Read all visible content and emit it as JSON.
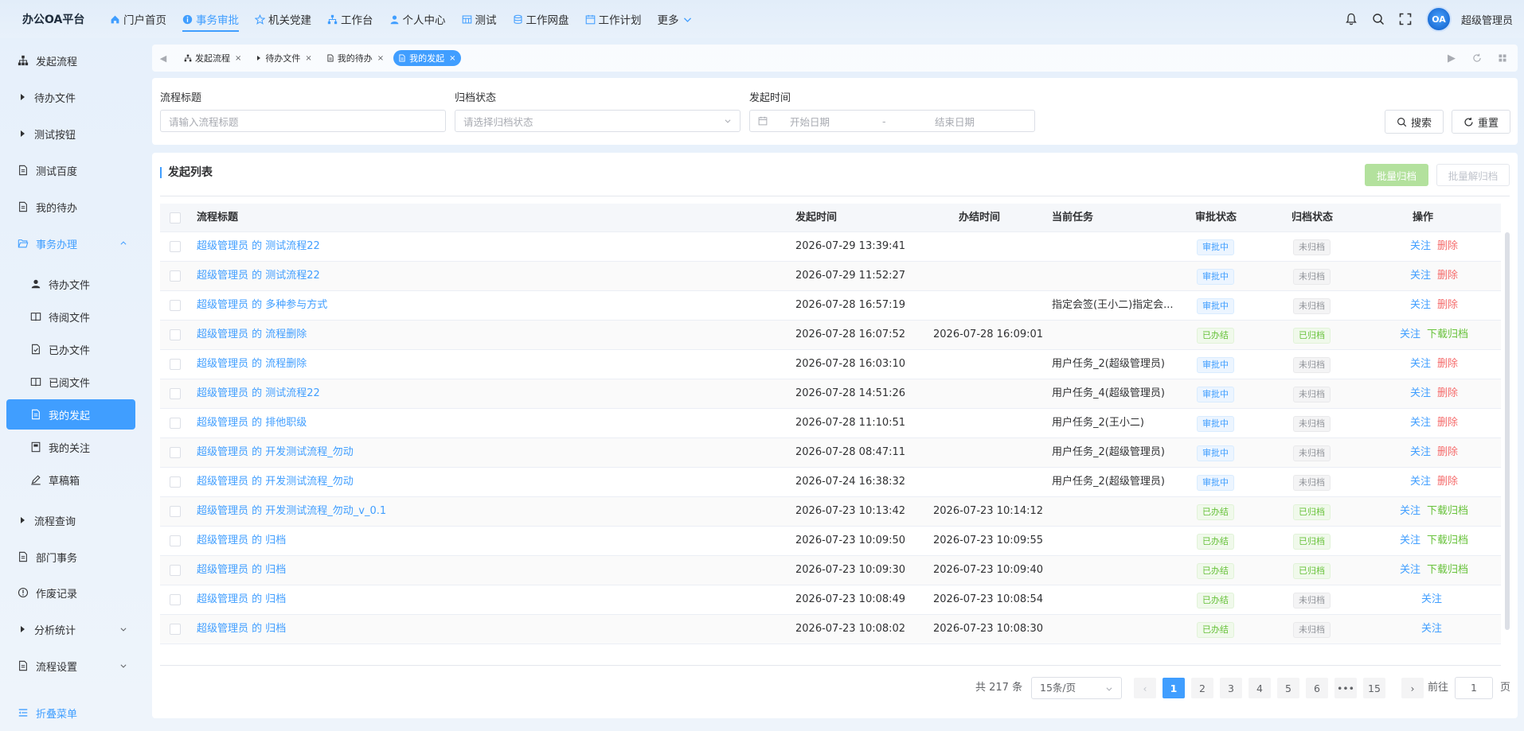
{
  "app": {
    "brand": "办公OA平台"
  },
  "topnav": [
    {
      "label": "门户首页",
      "icon": "home-icon",
      "active": false
    },
    {
      "label": "事务审批",
      "icon": "info-icon",
      "active": true
    },
    {
      "label": "机关党建",
      "icon": "star-icon",
      "active": false
    },
    {
      "label": "工作台",
      "icon": "org-icon",
      "active": false
    },
    {
      "label": "个人中心",
      "icon": "user-icon",
      "active": false
    },
    {
      "label": "测试",
      "icon": "grid-icon",
      "active": false
    },
    {
      "label": "工作网盘",
      "icon": "database-icon",
      "active": false
    },
    {
      "label": "工作计划",
      "icon": "calendar-icon",
      "active": false
    },
    {
      "label": "更多",
      "icon": "chevron-down-icon",
      "active": false
    }
  ],
  "user": {
    "avatar_text": "OA",
    "name": "超级管理员"
  },
  "sidebar": {
    "items": [
      {
        "label": "发起流程",
        "icon": "org-icon"
      },
      {
        "label": "待办文件",
        "icon": "triangle-right-icon"
      },
      {
        "label": "测试按钮",
        "icon": "triangle-right-icon"
      },
      {
        "label": "测试百度",
        "icon": "document-icon"
      },
      {
        "label": "我的待办",
        "icon": "document-icon"
      },
      {
        "label": "事务办理",
        "icon": "folder-open-icon"
      },
      {
        "label": "待办文件",
        "icon": "user-icon"
      },
      {
        "label": "待阅文件",
        "icon": "book-icon"
      },
      {
        "label": "已办文件",
        "icon": "document-check-icon"
      },
      {
        "label": "已阅文件",
        "icon": "book-icon"
      },
      {
        "label": "我的发起",
        "icon": "document-icon"
      },
      {
        "label": "我的关注",
        "icon": "notebook-icon"
      },
      {
        "label": "草稿箱",
        "icon": "edit-icon"
      },
      {
        "label": "流程查询",
        "icon": "triangle-right-icon"
      },
      {
        "label": "部门事务",
        "icon": "document-icon"
      },
      {
        "label": "作废记录",
        "icon": "warning-icon"
      },
      {
        "label": "分析统计",
        "icon": "triangle-right-icon"
      },
      {
        "label": "流程设置",
        "icon": "document-icon"
      }
    ],
    "collapse_label": "折叠菜单"
  },
  "tabs": [
    {
      "label": "发起流程",
      "icon": "org-icon",
      "active": false
    },
    {
      "label": "待办文件",
      "icon": "triangle-right-icon",
      "active": false
    },
    {
      "label": "我的待办",
      "icon": "document-icon",
      "active": false
    },
    {
      "label": "我的发起",
      "icon": "document-icon",
      "active": true
    }
  ],
  "search": {
    "title_label": "流程标题",
    "title_placeholder": "请输入流程标题",
    "archive_label": "归档状态",
    "archive_placeholder": "请选择归档状态",
    "time_label": "发起时间",
    "start_placeholder": "开始日期",
    "range_sep": "-",
    "end_placeholder": "结束日期",
    "search_button": "搜索",
    "reset_button": "重置"
  },
  "list": {
    "title": "发起列表",
    "bulk_archive": "批量归档",
    "bulk_unarchive": "批量解归档",
    "columns": [
      "流程标题",
      "发起时间",
      "办结时间",
      "当前任务",
      "审批状态",
      "归档状态",
      "操作"
    ],
    "rows": [
      {
        "title": "超级管理员 的 测试流程22",
        "start": "2026-07-29 13:39:41",
        "end": "",
        "task": "",
        "approval": "审批中",
        "archive": "未归档",
        "actions": [
          "关注",
          "删除"
        ]
      },
      {
        "title": "超级管理员 的 测试流程22",
        "start": "2026-07-29 11:52:27",
        "end": "",
        "task": "",
        "approval": "审批中",
        "archive": "未归档",
        "actions": [
          "关注",
          "删除"
        ]
      },
      {
        "title": "超级管理员 的 多种参与方式",
        "start": "2026-07-28 16:57:19",
        "end": "",
        "task": "指定会签(王小二)指定会...",
        "approval": "审批中",
        "archive": "未归档",
        "actions": [
          "关注",
          "删除"
        ]
      },
      {
        "title": "超级管理员 的 流程删除",
        "start": "2026-07-28 16:07:52",
        "end": "2026-07-28 16:09:01",
        "task": "",
        "approval": "已办结",
        "archive": "已归档",
        "actions": [
          "关注",
          "下载归档"
        ]
      },
      {
        "title": "超级管理员 的 流程删除",
        "start": "2026-07-28 16:03:10",
        "end": "",
        "task": "用户任务_2(超级管理员)",
        "approval": "审批中",
        "archive": "未归档",
        "actions": [
          "关注",
          "删除"
        ]
      },
      {
        "title": "超级管理员 的 测试流程22",
        "start": "2026-07-28 14:51:26",
        "end": "",
        "task": "用户任务_4(超级管理员)",
        "approval": "审批中",
        "archive": "未归档",
        "actions": [
          "关注",
          "删除"
        ]
      },
      {
        "title": "超级管理员 的 排他职级",
        "start": "2026-07-28 11:10:51",
        "end": "",
        "task": "用户任务_2(王小二)",
        "approval": "审批中",
        "archive": "未归档",
        "actions": [
          "关注",
          "删除"
        ]
      },
      {
        "title": "超级管理员 的 开发测试流程_勿动",
        "start": "2026-07-28 08:47:11",
        "end": "",
        "task": "用户任务_2(超级管理员)",
        "approval": "审批中",
        "archive": "未归档",
        "actions": [
          "关注",
          "删除"
        ]
      },
      {
        "title": "超级管理员 的 开发测试流程_勿动",
        "start": "2026-07-24 16:38:32",
        "end": "",
        "task": "用户任务_2(超级管理员)",
        "approval": "审批中",
        "archive": "未归档",
        "actions": [
          "关注",
          "删除"
        ]
      },
      {
        "title": "超级管理员 的 开发测试流程_勿动_v_0.1",
        "start": "2026-07-23 10:13:42",
        "end": "2026-07-23 10:14:12",
        "task": "",
        "approval": "已办结",
        "archive": "已归档",
        "actions": [
          "关注",
          "下载归档"
        ]
      },
      {
        "title": "超级管理员 的 归档",
        "start": "2026-07-23 10:09:50",
        "end": "2026-07-23 10:09:55",
        "task": "",
        "approval": "已办结",
        "archive": "已归档",
        "actions": [
          "关注",
          "下载归档"
        ]
      },
      {
        "title": "超级管理员 的 归档",
        "start": "2026-07-23 10:09:30",
        "end": "2026-07-23 10:09:40",
        "task": "",
        "approval": "已办结",
        "archive": "已归档",
        "actions": [
          "关注",
          "下载归档"
        ]
      },
      {
        "title": "超级管理员 的 归档",
        "start": "2026-07-23 10:08:49",
        "end": "2026-07-23 10:08:54",
        "task": "",
        "approval": "已办结",
        "archive": "未归档",
        "actions": [
          "关注"
        ]
      },
      {
        "title": "超级管理员 的 归档",
        "start": "2026-07-23 10:08:02",
        "end": "2026-07-23 10:08:30",
        "task": "",
        "approval": "已办结",
        "archive": "未归档",
        "actions": [
          "关注"
        ]
      }
    ]
  },
  "pagination": {
    "total_text": "共 217 条",
    "page_size": "15条/页",
    "pages": [
      "1",
      "2",
      "3",
      "4",
      "5",
      "6",
      "•••",
      "15"
    ],
    "current": "1",
    "goto_label": "前往",
    "goto_value": "1",
    "page_unit": "页"
  },
  "colors": {
    "primary": "#409eff",
    "success": "#67c23a",
    "danger": "#f56c6c"
  }
}
